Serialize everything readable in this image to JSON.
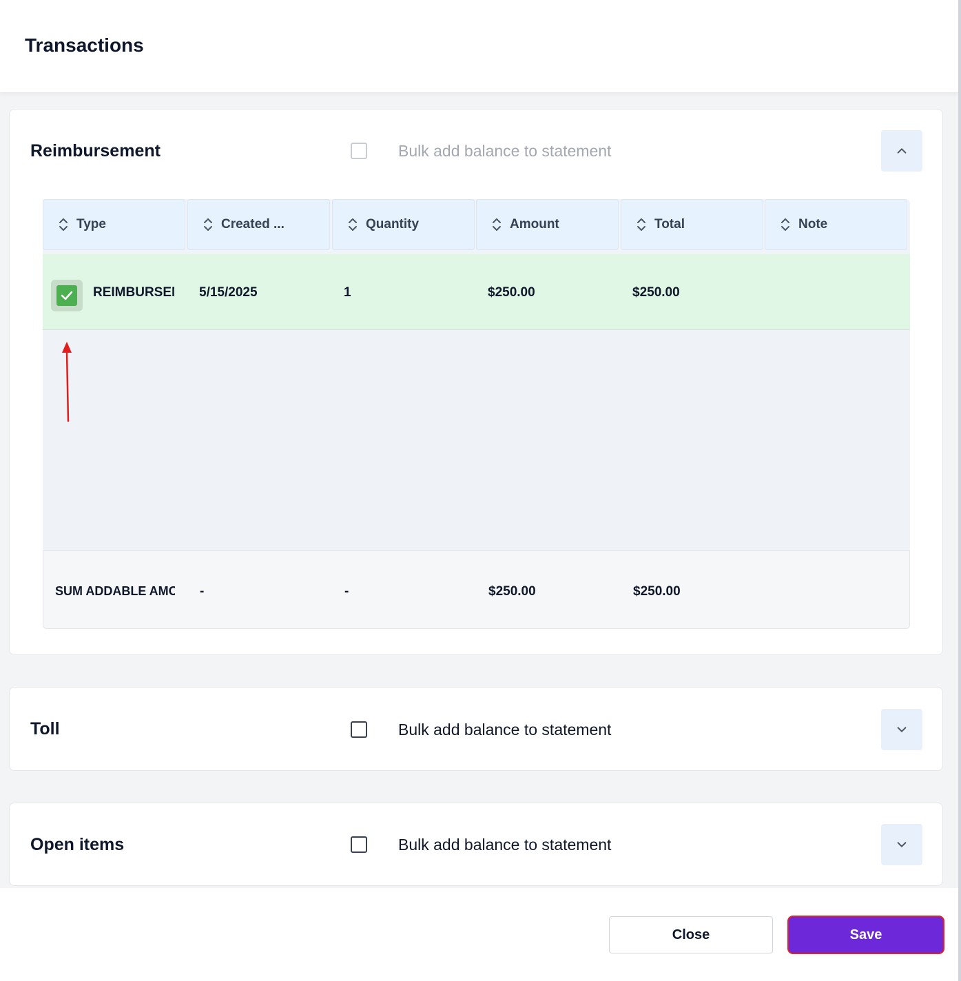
{
  "header": {
    "title": "Transactions"
  },
  "sections": [
    {
      "title": "Reimbursement",
      "bulk_label": "Bulk add balance to statement",
      "bulk_checked": false,
      "bulk_disabled": true,
      "expanded": true,
      "toggle_icon": "chevron-up-icon"
    },
    {
      "title": "Toll",
      "bulk_label": "Bulk add balance to statement",
      "bulk_checked": false,
      "bulk_disabled": false,
      "expanded": false,
      "toggle_icon": "chevron-down-icon"
    },
    {
      "title": "Open items",
      "bulk_label": "Bulk add balance to statement",
      "bulk_checked": false,
      "bulk_disabled": false,
      "expanded": false,
      "toggle_icon": "chevron-down-icon"
    }
  ],
  "table": {
    "columns": [
      "Type",
      "Created ...",
      "Quantity",
      "Amount",
      "Total",
      "Note"
    ],
    "rows": [
      {
        "selected": true,
        "type": "REIMBURSEMENT",
        "created": "5/15/2025",
        "quantity": "1",
        "amount": "$250.00",
        "total": "$250.00",
        "note": ""
      }
    ],
    "summary": {
      "label": "SUM ADDABLE AMOUNT",
      "created": "-",
      "quantity": "-",
      "amount": "$250.00",
      "total": "$250.00",
      "note": ""
    }
  },
  "footer": {
    "close_label": "Close",
    "save_label": "Save"
  },
  "colors": {
    "accent": "#6d28d9",
    "selected_row": "#e1f7e5",
    "check_green": "#4caf50",
    "highlight_red": "#dc2626"
  }
}
